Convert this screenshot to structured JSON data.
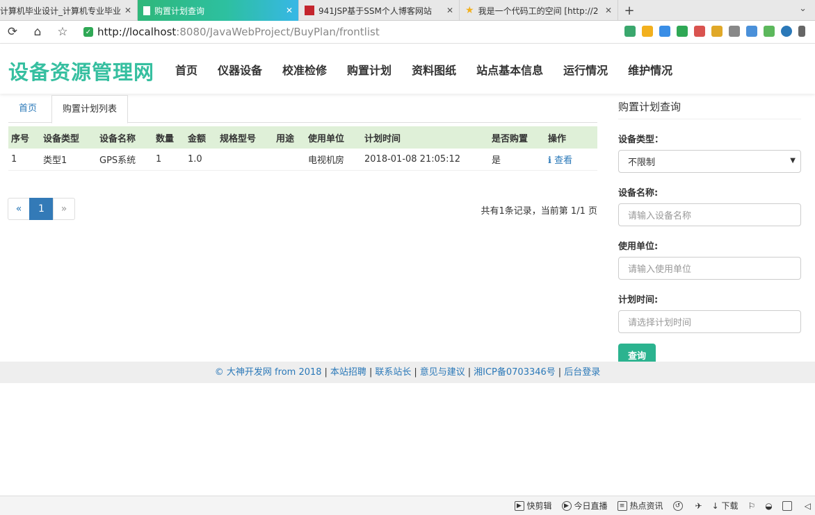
{
  "browser": {
    "tabs": [
      {
        "title": "计算机毕业设计_计算机专业毕业",
        "icon": "none"
      },
      {
        "title": "购置计划查询",
        "icon": "document-icon"
      },
      {
        "title": "941JSP基于SSM个人博客网站",
        "icon": "red-favicon"
      },
      {
        "title": "我是一个代码工的空间 [http://2",
        "icon": "star-icon"
      }
    ],
    "new_tab": "+",
    "url_host": "http://localhost",
    "url_path": ":8080/JavaWebProject/BuyPlan/frontlist"
  },
  "site": {
    "logo": "设备资源管理网",
    "nav": [
      "首页",
      "仪器设备",
      "校准检修",
      "购置计划",
      "资料图纸",
      "站点基本信息",
      "运行情况",
      "维护情况"
    ]
  },
  "content": {
    "tab_home": "首页",
    "tab_current": "购置计划列表",
    "table": {
      "headers": [
        "序号",
        "设备类型",
        "设备名称",
        "数量",
        "金额",
        "规格型号",
        "用途",
        "使用单位",
        "计划时间",
        "是否购置",
        "操作"
      ],
      "rows": [
        [
          "1",
          "类型1",
          "GPS系统",
          "1",
          "1.0",
          "",
          "",
          "电视机房",
          "2018-01-08 21:05:12",
          "是",
          "查看"
        ]
      ]
    },
    "pager": {
      "prev": "«",
      "current": "1",
      "next": "»"
    },
    "record_info": "共有1条记录，当前第 1/1 页"
  },
  "search": {
    "title": "购置计划查询",
    "type_label": "设备类型：",
    "type_value": "不限制",
    "name_label": "设备名称:",
    "name_placeholder": "请输入设备名称",
    "unit_label": "使用单位:",
    "unit_placeholder": "请输入使用单位",
    "time_label": "计划时间:",
    "time_placeholder": "请选择计划时间",
    "submit": "查询"
  },
  "footer": {
    "copyright": "© 大神开发网 from 2018",
    "links": [
      "本站招聘",
      "联系站长",
      "意见与建议",
      "湘ICP备0703346号",
      "后台登录"
    ]
  },
  "statusbar": [
    "快剪辑",
    "今日直播",
    "热点资讯",
    "下载"
  ]
}
